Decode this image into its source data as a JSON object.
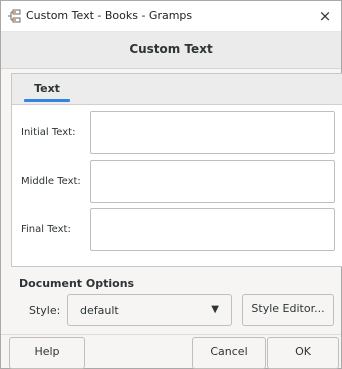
{
  "window": {
    "title": "Custom Text - Books - Gramps",
    "close_glyph": "×",
    "app_icon": "gramps-tree-icon"
  },
  "header": {
    "title": "Custom Text"
  },
  "tabs": [
    {
      "label": "Text",
      "active": true
    }
  ],
  "fields": [
    {
      "label": "Initial Text:",
      "value": ""
    },
    {
      "label": "Middle Text:",
      "value": ""
    },
    {
      "label": "Final Text:",
      "value": ""
    }
  ],
  "document_options": {
    "heading": "Document Options",
    "style_label": "Style:",
    "style_value": "default",
    "style_editor_label": "Style Editor..."
  },
  "buttons": {
    "help": "Help",
    "cancel": "Cancel",
    "ok": "OK"
  },
  "colors": {
    "accent": "#3584e4",
    "window_bg": "#f6f5f4"
  }
}
